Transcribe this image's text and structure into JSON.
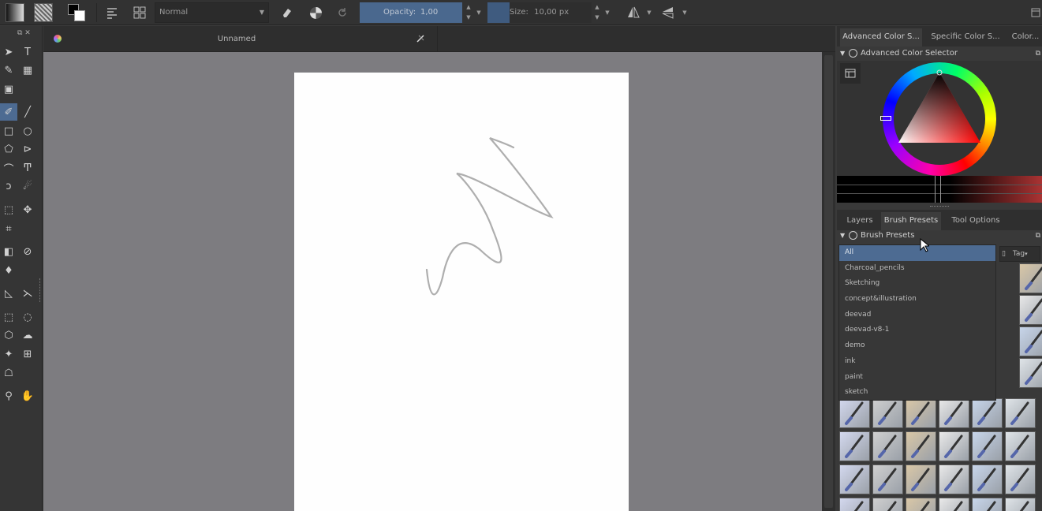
{
  "toolbar": {
    "blend_mode": "Normal",
    "opacity_label": "Opacity:",
    "opacity_value": "1,00",
    "size_label": "Size:",
    "size_value": "10,00 px",
    "opacity_level": 1.0
  },
  "document": {
    "title": "Unnamed"
  },
  "dock": {
    "top_tabs": [
      "Advanced Color S...",
      "Specific Color S...",
      "Color..."
    ],
    "color_selector_title": "Advanced Color Selector",
    "mid_tabs": [
      "Layers",
      "Brush Presets",
      "Tool Options"
    ],
    "brush_presets_title": "Brush Presets",
    "tag_label": "Tag"
  },
  "tag_dropdown": {
    "options": [
      "All",
      "Charcoal_pencils",
      "Sketching",
      "concept&illustration",
      "deevad",
      "deevad-v8-1",
      "demo",
      "ink",
      "paint",
      "sketch"
    ],
    "selected_index": 0
  },
  "colors": {
    "accent": "#4d6b92",
    "canvas_bg": "#7d7c80",
    "paper": "#fefefe",
    "panel": "#393939"
  },
  "icons": {
    "toolbox": [
      "select-shapes-icon",
      "text-icon",
      "calligraphy-icon",
      "edit-shapes-icon",
      "pattern-icon",
      "brush-icon",
      "line-icon",
      "rectangle-icon",
      "ellipse-icon",
      "polygon-icon",
      "polyline-icon",
      "bezier-icon",
      "freehand-path-icon",
      "dynamic-brush-icon",
      "multibrush-icon",
      "transform-icon",
      "move-icon",
      "crop-icon",
      "gradient-icon",
      "color-picker-icon",
      "fill-icon",
      "assistant-icon",
      "measure-icon",
      "rect-select-icon",
      "ellipse-select-icon",
      "polygon-select-icon",
      "freehand-select-icon",
      "contiguous-select-icon",
      "similar-select-icon",
      "bezier-select-icon",
      "zoom-icon",
      "pan-icon"
    ]
  }
}
